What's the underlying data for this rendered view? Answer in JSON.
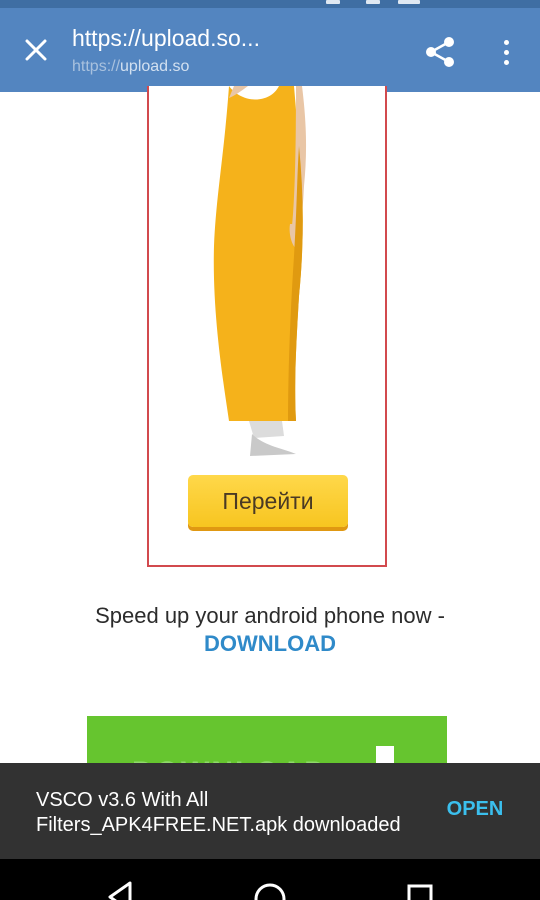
{
  "toolbar": {
    "title": "https://upload.so...",
    "url_scheme": "https://",
    "url_host": "upload.so",
    "close_icon": "close-icon",
    "share_icon": "share-icon",
    "more_icon": "more-vert-icon"
  },
  "ad": {
    "cta_label": "Перейти",
    "border_color": "#d24a4e",
    "dress_color": "#f5b21b"
  },
  "promo": {
    "text": "Speed up your android phone now -",
    "link": "DOWNLOAD",
    "link_color": "#2f8ac9"
  },
  "banner": {
    "label": "DOWNLOAD",
    "color": "#66c52f"
  },
  "snackbar": {
    "message": "VSCO v3.6 With All Filters_APK4FREE.NET.apk downloaded",
    "action": "OPEN",
    "action_color": "#3bbfed"
  },
  "nav": {
    "back_icon": "back-icon",
    "home_icon": "home-icon",
    "recents_icon": "recents-icon"
  },
  "colors": {
    "toolbar": "#5385c0",
    "status_bar": "#3f6ea3"
  }
}
